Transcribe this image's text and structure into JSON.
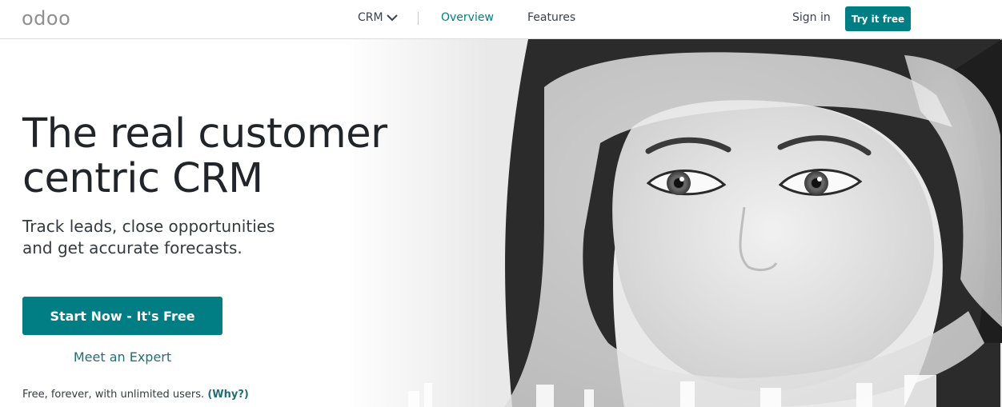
{
  "header": {
    "logo": "odoo",
    "nav": {
      "crm_label": "CRM",
      "overview_label": "Overview",
      "features_label": "Features"
    },
    "sign_in_label": "Sign in",
    "try_label": "Try it free"
  },
  "hero": {
    "headline_line1": "The real customer",
    "headline_line2": "centric CRM",
    "subhead_line1": "Track leads, close opportunities",
    "subhead_line2": "and get accurate forecasts.",
    "start_label": "Start Now - It's Free",
    "expert_label": "Meet an Expert",
    "free_note": "Free, forever, with unlimited users.",
    "why_label": "(Why?)"
  },
  "colors": {
    "brand_teal": "#017e84",
    "link_teal": "#1f6f78",
    "text_dark": "#212529",
    "logo_gray": "#8f8f8f"
  },
  "icons": {
    "crm_dropdown": "chevron-down-icon"
  }
}
